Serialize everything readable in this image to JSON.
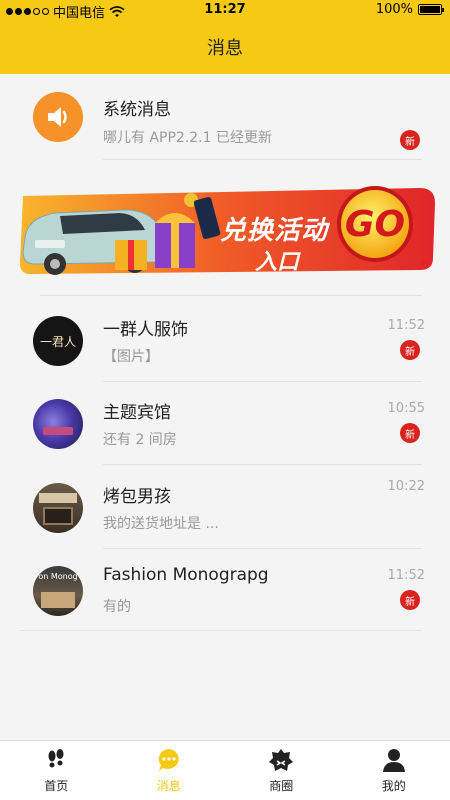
{
  "status_bar": {
    "carrier": "中国电信",
    "time": "11:27",
    "battery": "100%",
    "battery_level": 1.0
  },
  "header": {
    "title": "消息"
  },
  "system_message": {
    "name": "系统消息",
    "preview": "哪儿有 APP2.2.1 已经更新",
    "badge": "新"
  },
  "banner": {
    "text_top": "兑换活动",
    "text_bottom": "入口",
    "go_label": "GO"
  },
  "chats": [
    {
      "name": "一群人服饰",
      "preview": "【图片】",
      "time": "11:52",
      "badge": "新",
      "avatar_text": "一君人"
    },
    {
      "name": "主题宾馆",
      "preview": "还有 2 间房",
      "time": "10:55",
      "badge": "新"
    },
    {
      "name": "烤包男孩",
      "preview": "我的送货地址是 ...",
      "time": "10:22"
    },
    {
      "name": "Fashion Monograpg",
      "preview": "有的",
      "time": "11:52",
      "badge": "新",
      "avatar_text": "on Monog"
    }
  ],
  "tabbar": {
    "items": [
      {
        "label": "首页",
        "icon": "footprints-icon"
      },
      {
        "label": "消息",
        "icon": "chat-bubble-icon",
        "active": true
      },
      {
        "label": "商圈",
        "icon": "shop-circle-icon"
      },
      {
        "label": "我的",
        "icon": "user-icon"
      }
    ]
  },
  "colors": {
    "brand_yellow": "#f5c914",
    "badge_red": "#d8231e",
    "system_orange": "#f7922a"
  }
}
